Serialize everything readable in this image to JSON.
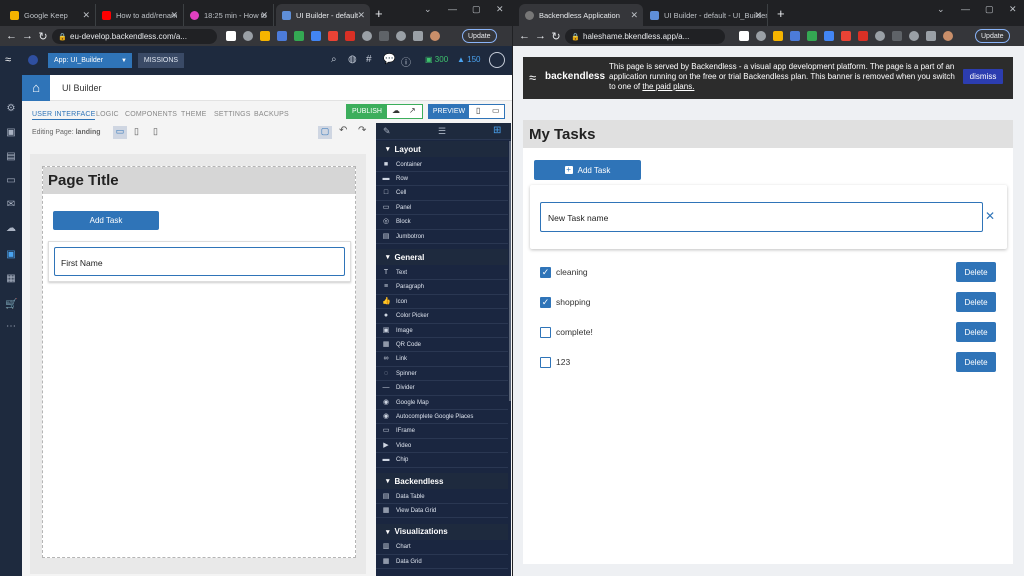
{
  "left_window": {
    "tabs": [
      {
        "title": "Google Keep",
        "color": "#f6b400"
      },
      {
        "title": "How to add/renam",
        "color": "#ff0000"
      },
      {
        "title": "18:25 min - How to",
        "color": "#e040c0"
      },
      {
        "title": "UI Builder - default",
        "color": "#5f8fd8"
      }
    ],
    "url": "eu-develop.backendless.com/a...",
    "update_label": "Update",
    "app": {
      "app_selector": "App: UI_Builder",
      "missions_label": "MISSIONS",
      "points_green": "300",
      "points_blue": "150",
      "page_header": "UI Builder",
      "subtabs": [
        "USER INTERFACE",
        "LOGIC",
        "COMPONENTS",
        "THEME",
        "SETTINGS",
        "BACKUPS"
      ],
      "publish_label": "PUBLISH",
      "preview_label": "PREVIEW",
      "editing_label": "Editing Page:",
      "editing_page": "landing",
      "canvas": {
        "page_title": "Page Title",
        "add_task_label": "Add Task",
        "input_value": "First Name"
      },
      "palette": {
        "sections": [
          {
            "title": "Layout",
            "items": [
              {
                "label": "Container",
                "icon": "■"
              },
              {
                "label": "Row",
                "icon": "▬"
              },
              {
                "label": "Cell",
                "icon": "□"
              },
              {
                "label": "Panel",
                "icon": "▭"
              },
              {
                "label": "Block",
                "icon": "◎"
              },
              {
                "label": "Jumbotron",
                "icon": "▤"
              }
            ]
          },
          {
            "title": "General",
            "items": [
              {
                "label": "Text",
                "icon": "T"
              },
              {
                "label": "Paragraph",
                "icon": "≡"
              },
              {
                "label": "Icon",
                "icon": "👍"
              },
              {
                "label": "Color Picker",
                "icon": "●"
              },
              {
                "label": "Image",
                "icon": "▣"
              },
              {
                "label": "QR Code",
                "icon": "▦"
              },
              {
                "label": "Link",
                "icon": "∞"
              },
              {
                "label": "Spinner",
                "icon": "◌"
              },
              {
                "label": "Divider",
                "icon": "—"
              },
              {
                "label": "Google Map",
                "icon": "◉"
              },
              {
                "label": "Autocomplete Google Places",
                "icon": "◉"
              },
              {
                "label": "IFrame",
                "icon": "▭"
              },
              {
                "label": "Video",
                "icon": "▶"
              },
              {
                "label": "Chip",
                "icon": "▬"
              }
            ]
          },
          {
            "title": "Backendless",
            "items": [
              {
                "label": "Data Table",
                "icon": "▤"
              },
              {
                "label": "View Data Grid",
                "icon": "▦"
              }
            ]
          },
          {
            "title": "Visualizations",
            "items": [
              {
                "label": "Chart",
                "icon": "▥"
              },
              {
                "label": "Data Grid",
                "icon": "▦"
              }
            ]
          }
        ]
      }
    }
  },
  "right_window": {
    "tabs": [
      {
        "title": "Backendless Application",
        "color": "#777777"
      },
      {
        "title": "UI Builder - default - UI_Builder",
        "color": "#5f8fd8"
      }
    ],
    "url": "haleshame.bkendless.app/a...",
    "update_label": "Update",
    "banner": {
      "logo_text": "backendless",
      "message": "This page is served by Backendless - a visual app development platform. The page is a part of an application running on the free or trial Backendless plan. This banner is removed when you switch to one of",
      "link_text": "the paid plans.",
      "dismiss_label": "dismiss"
    },
    "app": {
      "title": "My Tasks",
      "add_task_label": "Add Task",
      "new_task_value": "New Task name",
      "delete_label": "Delete",
      "tasks": [
        {
          "label": "cleaning",
          "checked": true
        },
        {
          "label": "shopping",
          "checked": true
        },
        {
          "label": "complete!",
          "checked": false
        },
        {
          "label": "123",
          "checked": false
        }
      ]
    }
  }
}
